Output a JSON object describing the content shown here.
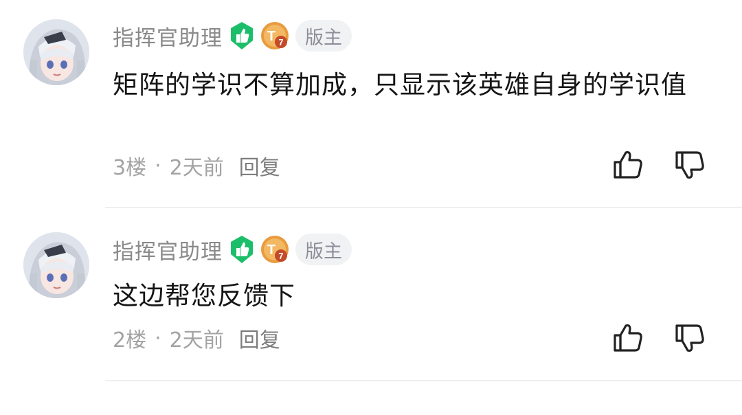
{
  "colors": {
    "like_badge": "#1cbe6a",
    "level_badge": "#e89b3e",
    "level_badge_mark": "#c44a2a",
    "username": "#8a8a8a",
    "meta": "#a3a3a3",
    "divider": "#efefef"
  },
  "comments": [
    {
      "username": "指挥官助理",
      "like_badge_icon": "thumbs-up-badge-icon",
      "level_badge_icon": "level-badge-icon",
      "level_text": "T7",
      "role_tag": "版主",
      "text": "矩阵的学识不算加成，只显示该英雄自身的学识值",
      "floor": "3楼",
      "separator": "·",
      "time": "2天前",
      "reply_label": "回复",
      "like_icon": "thumbs-up-icon",
      "dislike_icon": "thumbs-down-icon"
    },
    {
      "username": "指挥官助理",
      "like_badge_icon": "thumbs-up-badge-icon",
      "level_badge_icon": "level-badge-icon",
      "level_text": "T7",
      "role_tag": "版主",
      "text": "这边帮您反馈下",
      "floor": "2楼",
      "separator": "·",
      "time": "2天前",
      "reply_label": "回复",
      "like_icon": "thumbs-up-icon",
      "dislike_icon": "thumbs-down-icon"
    }
  ]
}
